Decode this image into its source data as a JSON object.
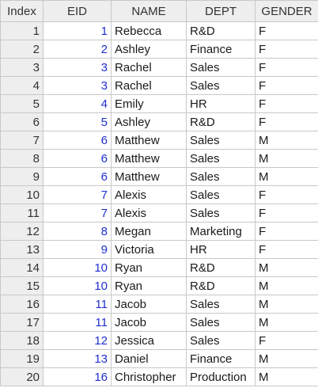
{
  "colors": {
    "header_bg": "#eeeeee",
    "grid_line": "#c8c8c8",
    "eid_text": "#1f2fd0",
    "text": "#1a1a1a"
  },
  "table": {
    "columns": [
      "Index",
      "EID",
      "NAME",
      "DEPT",
      "GENDER"
    ],
    "rows": [
      {
        "index": "1",
        "eid": "1",
        "name": "Rebecca",
        "dept": "R&D",
        "gender": "F"
      },
      {
        "index": "2",
        "eid": "2",
        "name": "Ashley",
        "dept": "Finance",
        "gender": "F"
      },
      {
        "index": "3",
        "eid": "3",
        "name": "Rachel",
        "dept": "Sales",
        "gender": "F"
      },
      {
        "index": "4",
        "eid": "3",
        "name": "Rachel",
        "dept": "Sales",
        "gender": "F"
      },
      {
        "index": "5",
        "eid": "4",
        "name": "Emily",
        "dept": "HR",
        "gender": "F"
      },
      {
        "index": "6",
        "eid": "5",
        "name": "Ashley",
        "dept": "R&D",
        "gender": "F"
      },
      {
        "index": "7",
        "eid": "6",
        "name": "Matthew",
        "dept": "Sales",
        "gender": "M"
      },
      {
        "index": "8",
        "eid": "6",
        "name": "Matthew",
        "dept": "Sales",
        "gender": "M"
      },
      {
        "index": "9",
        "eid": "6",
        "name": "Matthew",
        "dept": "Sales",
        "gender": "M"
      },
      {
        "index": "10",
        "eid": "7",
        "name": "Alexis",
        "dept": "Sales",
        "gender": "F"
      },
      {
        "index": "11",
        "eid": "7",
        "name": "Alexis",
        "dept": "Sales",
        "gender": "F"
      },
      {
        "index": "12",
        "eid": "8",
        "name": "Megan",
        "dept": "Marketing",
        "gender": "F"
      },
      {
        "index": "13",
        "eid": "9",
        "name": "Victoria",
        "dept": "HR",
        "gender": "F"
      },
      {
        "index": "14",
        "eid": "10",
        "name": "Ryan",
        "dept": "R&D",
        "gender": "M"
      },
      {
        "index": "15",
        "eid": "10",
        "name": "Ryan",
        "dept": "R&D",
        "gender": "M"
      },
      {
        "index": "16",
        "eid": "11",
        "name": "Jacob",
        "dept": "Sales",
        "gender": "M"
      },
      {
        "index": "17",
        "eid": "11",
        "name": "Jacob",
        "dept": "Sales",
        "gender": "M"
      },
      {
        "index": "18",
        "eid": "12",
        "name": "Jessica",
        "dept": "Sales",
        "gender": "F"
      },
      {
        "index": "19",
        "eid": "13",
        "name": "Daniel",
        "dept": "Finance",
        "gender": "M"
      },
      {
        "index": "20",
        "eid": "16",
        "name": "Christopher",
        "dept": "Production",
        "gender": "M"
      }
    ]
  }
}
